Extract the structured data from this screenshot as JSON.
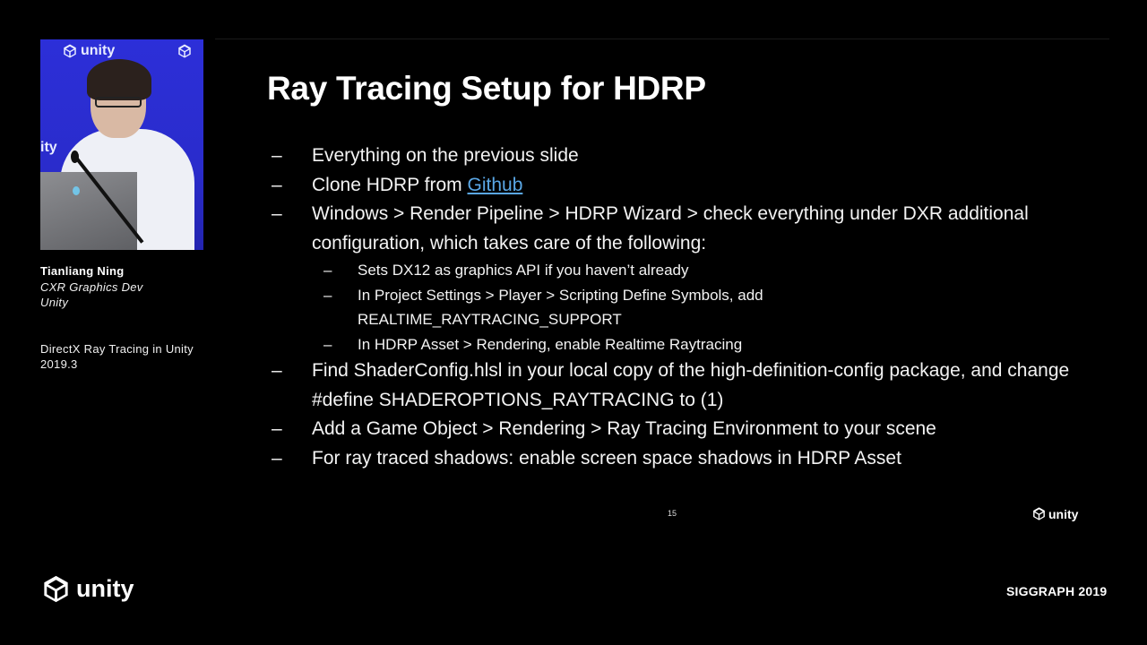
{
  "speaker": {
    "name": "Tianliang Ning",
    "role": "CXR Graphics Dev",
    "org": "Unity",
    "talk_title": "DirectX Ray Tracing in Unity 2019.3",
    "video_backdrop_logo": "unity",
    "video_backdrop_partial": "ity"
  },
  "slide": {
    "title": "Ray Tracing Setup for HDRP",
    "bullets": [
      {
        "dash": "–",
        "text": "Everything on the previous slide"
      },
      {
        "dash": "–",
        "text_before": "Clone HDRP from ",
        "link": "Github"
      },
      {
        "dash": "–",
        "text": "Windows > Render Pipeline > HDRP Wizard > check everything under DXR additional configuration, which takes care of the following:",
        "sub": [
          {
            "dash": "–",
            "text": "Sets DX12 as graphics API if you haven’t already"
          },
          {
            "dash": "–",
            "text": "In Project Settings > Player > Scripting Define Symbols, add REALTIME_RAYTRACING_SUPPORT"
          },
          {
            "dash": "–",
            "text": "In HDRP Asset > Rendering, enable Realtime Raytracing"
          }
        ]
      },
      {
        "dash": "–",
        "text": "Find ShaderConfig.hlsl in your local copy of the high-definition-config package, and change #define SHADEROPTIONS_RAYTRACING to (1)"
      },
      {
        "dash": "–",
        "text": "Add a Game Object > Rendering > Ray Tracing Environment to your scene"
      },
      {
        "dash": "–",
        "text": "For ray traced shadows: enable screen space shadows in HDRP Asset"
      }
    ],
    "page_number": "15",
    "logo_text": "unity",
    "link_color": "#5aa7e6"
  },
  "footer": {
    "logo_text": "unity",
    "event": "SIGGRAPH 2019"
  },
  "icons": {
    "unity_logo": "unity-cube-logo"
  }
}
